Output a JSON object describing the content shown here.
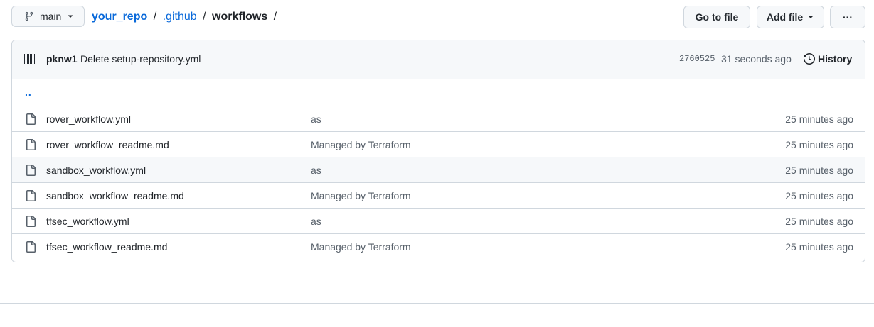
{
  "branch": {
    "name": "main"
  },
  "breadcrumb": {
    "repo": "your_repo",
    "sep1": "/",
    "dir1": ".github",
    "sep2": "/",
    "current": "workflows",
    "sep3": "/"
  },
  "toolbar": {
    "goto_label": "Go to file",
    "add_label": "Add file",
    "more_label": "···"
  },
  "commit": {
    "author": "pknw1",
    "message": "Delete setup-repository.yml",
    "sha": "2760525",
    "time": "31 seconds ago",
    "history_label": "History"
  },
  "parent_link": "..",
  "files": [
    {
      "name": "rover_workflow.yml",
      "message": "as",
      "age": "25 minutes ago"
    },
    {
      "name": "rover_workflow_readme.md",
      "message": "Managed by Terraform",
      "age": "25 minutes ago"
    },
    {
      "name": "sandbox_workflow.yml",
      "message": "as",
      "age": "25 minutes ago"
    },
    {
      "name": "sandbox_workflow_readme.md",
      "message": "Managed by Terraform",
      "age": "25 minutes ago"
    },
    {
      "name": "tfsec_workflow.yml",
      "message": "as",
      "age": "25 minutes ago"
    },
    {
      "name": "tfsec_workflow_readme.md",
      "message": "Managed by Terraform",
      "age": "25 minutes ago"
    }
  ],
  "colors": {
    "link": "#0969da",
    "text": "#1f2328",
    "muted": "#57606a",
    "border": "#d0d7de",
    "header_bg": "#f6f8fa"
  },
  "icons": {
    "branch": "git-branch-icon",
    "caret": "triangle-down-icon",
    "file": "file-icon",
    "history": "history-icon",
    "more": "kebab-horizontal-icon",
    "avatar": "avatar"
  }
}
